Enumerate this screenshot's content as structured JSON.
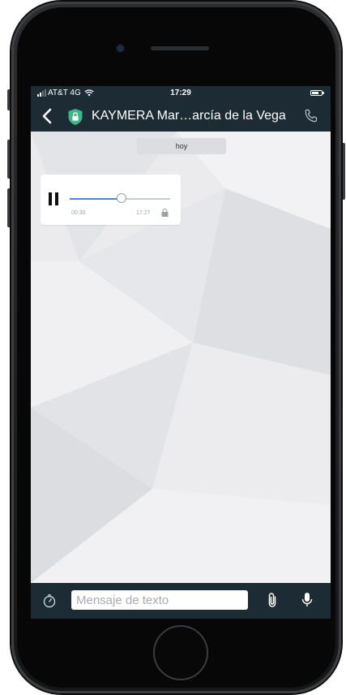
{
  "status_bar": {
    "carrier": "AT&T 4G",
    "time": "17:29"
  },
  "nav": {
    "title": "KAYMERA Mar…arcía de la Vega"
  },
  "chat": {
    "date_label": "hoy",
    "messages": [
      {
        "type": "voice",
        "duration": "00:30",
        "timestamp": "17:27",
        "progress": 0.52
      }
    ]
  },
  "input": {
    "placeholder": "Mensaje de texto"
  },
  "colors": {
    "bar_background": "#1d2b35",
    "accent_blue": "#3d8ddf",
    "shield_green": "#3fb58a",
    "chat_background": "#ebebed"
  },
  "icons": [
    "back-arrow-icon",
    "shield-lock-icon",
    "phone-icon",
    "pause-icon",
    "lock-icon",
    "timer-icon",
    "paperclip-icon",
    "microphone-icon",
    "wifi-icon",
    "battery-icon"
  ]
}
